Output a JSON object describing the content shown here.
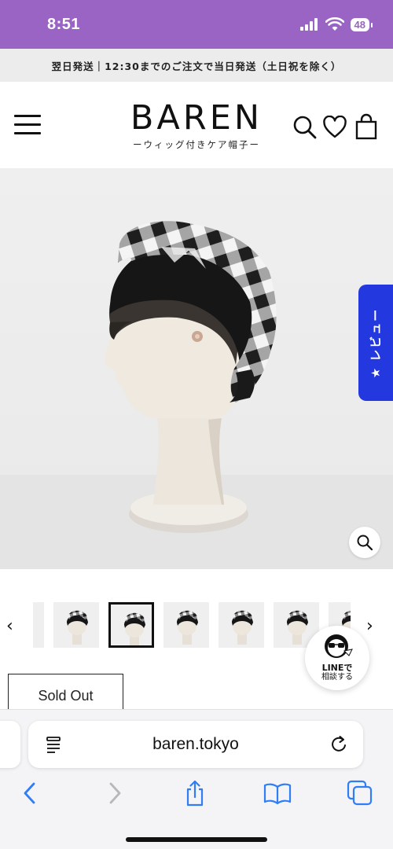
{
  "status_bar": {
    "time": "8:51",
    "battery": "48"
  },
  "announcement": {
    "text": "翌日発送｜12:30までのご注文で当日発送（土日祝を除く）"
  },
  "header": {
    "logo": "BAREN",
    "tagline": "ーウィッグ付きケア帽子ー"
  },
  "review_tab": {
    "star": "★",
    "label": "レビュー"
  },
  "thumbnails": {
    "prev": "‹",
    "next": "›",
    "active_index": 2,
    "count": 7
  },
  "line_button": {
    "brand": "LINE",
    "suffix": "で",
    "line2": "相談する"
  },
  "product": {
    "sold_out_label": "Sold Out"
  },
  "browser": {
    "url": "baren.tokyo"
  },
  "colors": {
    "status_bar": "#9a64c4",
    "review_tab": "#2438e0",
    "announcement_bg": "#ececec",
    "hero_bg": "#eeeeee"
  },
  "icons": {
    "header": [
      "menu-icon",
      "search-icon",
      "heart-icon",
      "bag-icon"
    ],
    "toolbar": [
      "back-icon",
      "forward-icon",
      "share-icon",
      "bookmarks-icon",
      "tabs-icon"
    ]
  }
}
